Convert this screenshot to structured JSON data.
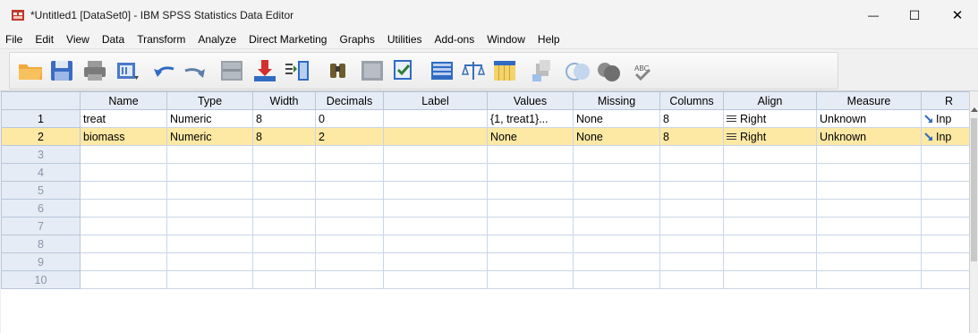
{
  "window": {
    "title": "*Untitled1 [DataSet0] - IBM SPSS Statistics Data Editor",
    "minimize_glyph": "—",
    "maximize_glyph": "☐",
    "close_glyph": "✕"
  },
  "menubar": {
    "items": [
      "File",
      "Edit",
      "View",
      "Data",
      "Transform",
      "Analyze",
      "Direct Marketing",
      "Graphs",
      "Utilities",
      "Add-ons",
      "Window",
      "Help"
    ]
  },
  "toolbar": {
    "icons": [
      "open-folder-icon",
      "save-icon",
      "print-icon",
      "dialog-recall-icon",
      "undo-icon",
      "redo-icon",
      "goto-case-icon",
      "goto-variable-icon",
      "variables-icon",
      "find-icon",
      "insert-cases-icon",
      "insert-variable-icon",
      "split-file-icon",
      "weight-cases-icon",
      "select-cases-icon",
      "value-labels-icon",
      "use-variable-sets-icon",
      "show-all-variables-icon",
      "spell-check-icon"
    ]
  },
  "accent": {
    "selected_row": "#fde9a4",
    "header_bg": "#e6ecf5",
    "grid_line": "#c9d6e6"
  },
  "grid": {
    "columns": [
      "Name",
      "Type",
      "Width",
      "Decimals",
      "Label",
      "Values",
      "Missing",
      "Columns",
      "Align",
      "Measure",
      "R"
    ],
    "rows": [
      {
        "num": "1",
        "name": "treat",
        "type": "Numeric",
        "width": "8",
        "decimals": "0",
        "label": "",
        "values": "{1, treat1}...",
        "missing": "None",
        "columns": "8",
        "align": "Right",
        "measure": "Unknown",
        "role": "Inp"
      },
      {
        "num": "2",
        "name": "biomass",
        "type": "Numeric",
        "width": "8",
        "decimals": "2",
        "label": "",
        "values": "None",
        "missing": "None",
        "columns": "8",
        "align": "Right",
        "measure": "Unknown",
        "role": "Inp"
      },
      {
        "num": "3"
      },
      {
        "num": "4"
      },
      {
        "num": "5"
      },
      {
        "num": "6"
      },
      {
        "num": "7"
      },
      {
        "num": "8"
      },
      {
        "num": "9"
      },
      {
        "num": "10"
      }
    ]
  }
}
